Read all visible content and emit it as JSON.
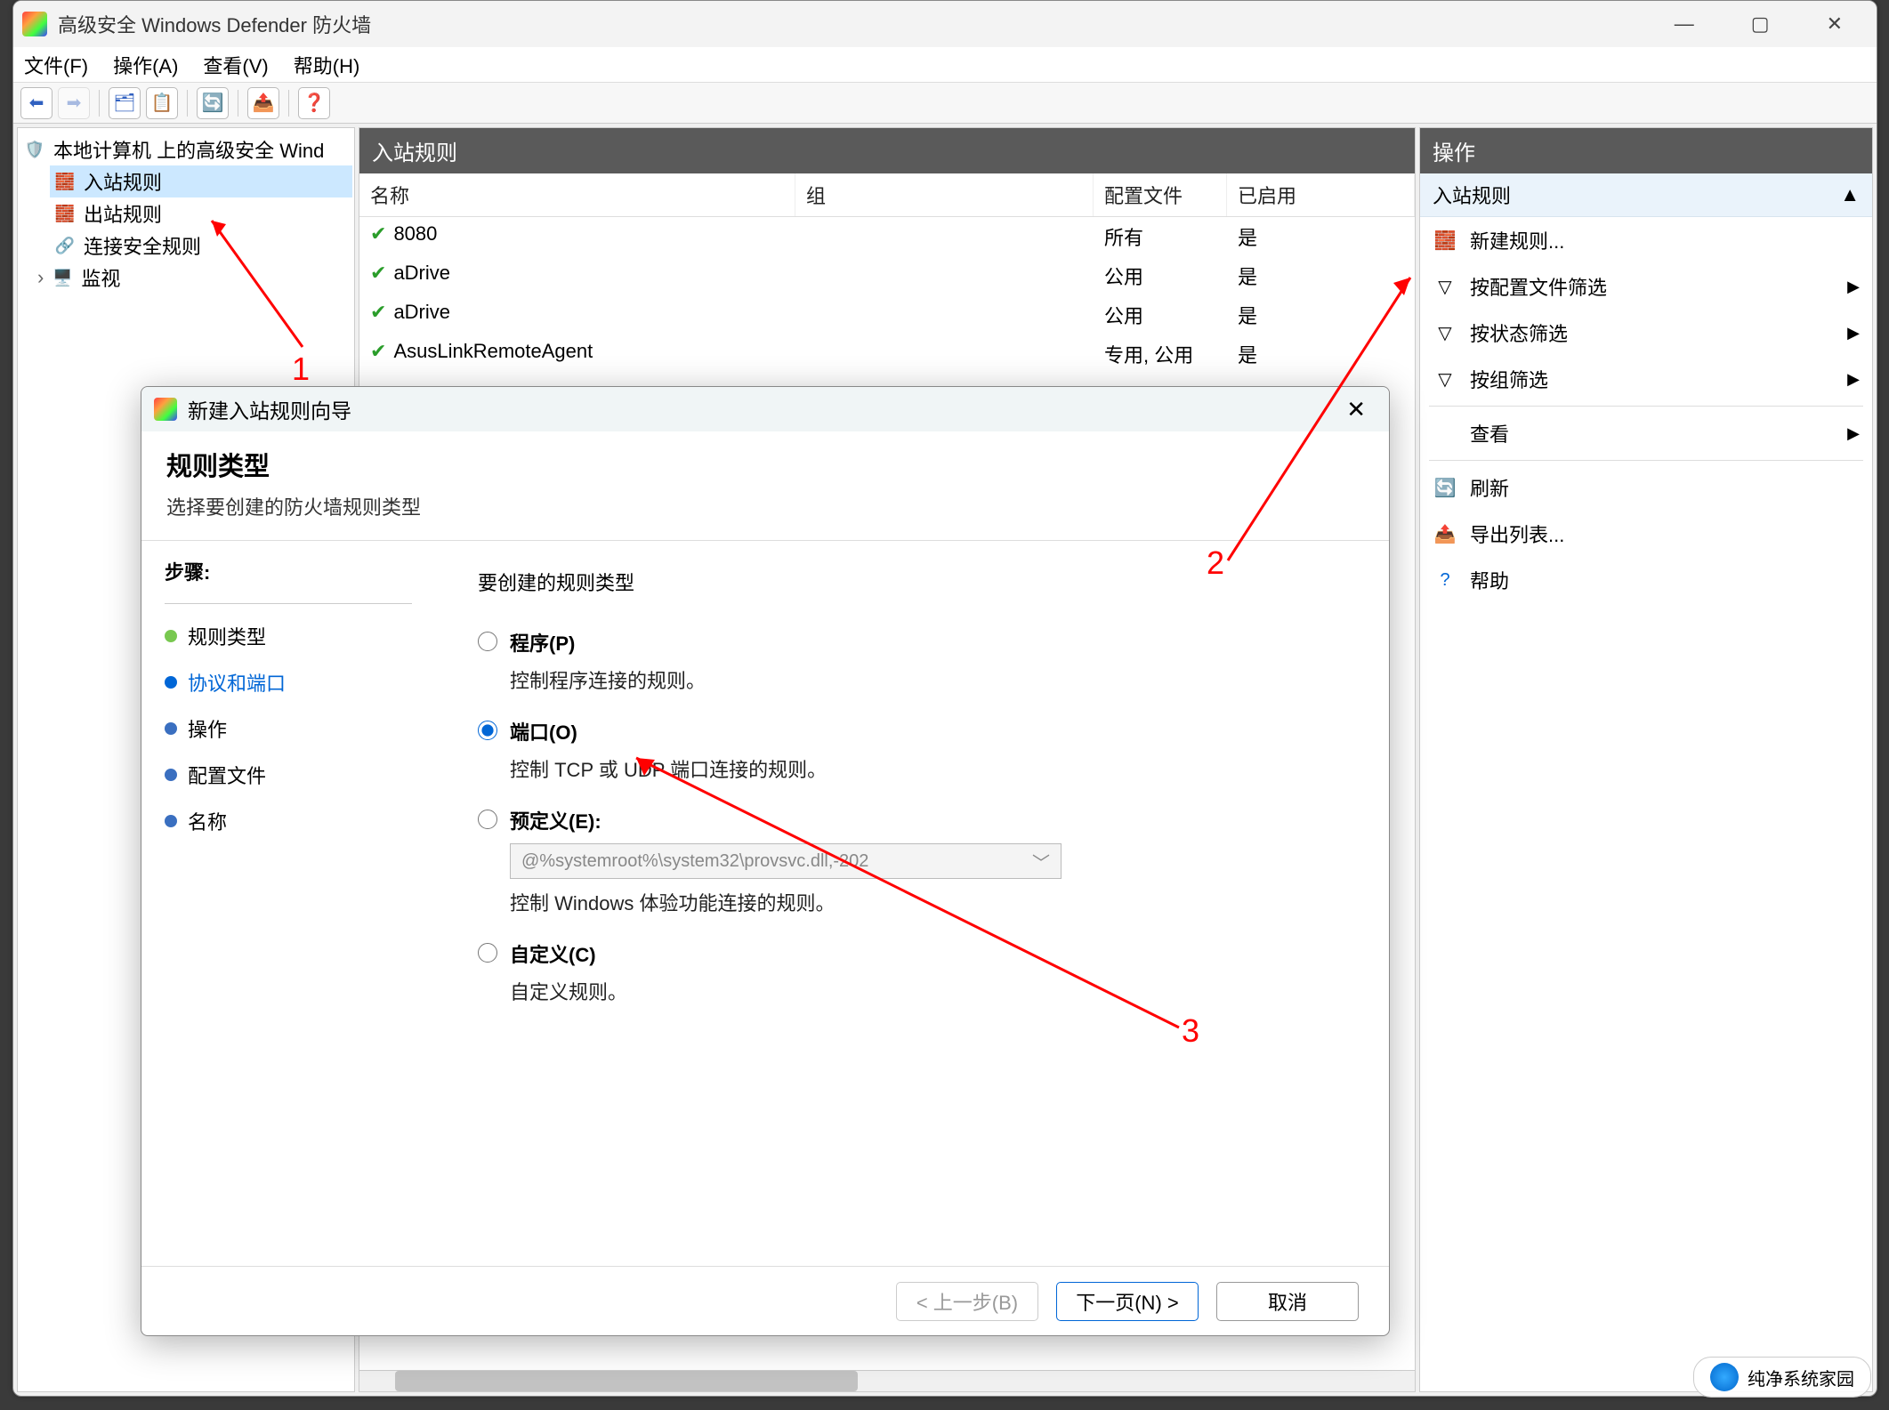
{
  "window": {
    "title": "高级安全 Windows Defender 防火墙"
  },
  "menu": {
    "file": "文件(F)",
    "action": "操作(A)",
    "view": "查看(V)",
    "help": "帮助(H)"
  },
  "tree": {
    "root": "本地计算机 上的高级安全 Wind",
    "inbound": "入站规则",
    "outbound": "出站规则",
    "connsec": "连接安全规则",
    "monitor": "监视"
  },
  "center": {
    "title": "入站规则",
    "cols": {
      "name": "名称",
      "group": "组",
      "profile": "配置文件",
      "enabled": "已启用"
    },
    "rules": [
      {
        "name": "8080",
        "profile": "所有",
        "enabled": "是"
      },
      {
        "name": "aDrive",
        "profile": "公用",
        "enabled": "是"
      },
      {
        "name": "aDrive",
        "profile": "公用",
        "enabled": "是"
      },
      {
        "name": "AsusLinkRemoteAgent",
        "profile": "专用, 公用",
        "enabled": "是"
      }
    ]
  },
  "actions": {
    "title": "操作",
    "group_title": "入站规则",
    "items": {
      "new_rule": "新建规则...",
      "filter_profile": "按配置文件筛选",
      "filter_state": "按状态筛选",
      "filter_group": "按组筛选",
      "view": "查看",
      "refresh": "刷新",
      "export": "导出列表...",
      "help": "帮助"
    }
  },
  "wizard": {
    "title": "新建入站规则向导",
    "heading": "规则类型",
    "subheading": "选择要创建的防火墙规则类型",
    "steps_label": "步骤:",
    "steps": {
      "rule_type": "规则类型",
      "protocol": "协议和端口",
      "action": "操作",
      "profile": "配置文件",
      "name": "名称"
    },
    "prompt": "要创建的规则类型",
    "opts": {
      "program_label": "程序(P)",
      "program_desc": "控制程序连接的规则。",
      "port_label": "端口(O)",
      "port_desc": "控制 TCP 或 UDP 端口连接的规则。",
      "predef_label": "预定义(E):",
      "predef_combo": "@%systemroot%\\system32\\provsvc.dll,-202",
      "predef_desc": "控制 Windows 体验功能连接的规则。",
      "custom_label": "自定义(C)",
      "custom_desc": "自定义规则。"
    },
    "buttons": {
      "back": "< 上一步(B)",
      "next": "下一页(N) >",
      "cancel": "取消"
    }
  },
  "annotations": {
    "n1": "1",
    "n2": "2",
    "n3": "3"
  },
  "watermark": {
    "text": "纯净系统家园"
  }
}
